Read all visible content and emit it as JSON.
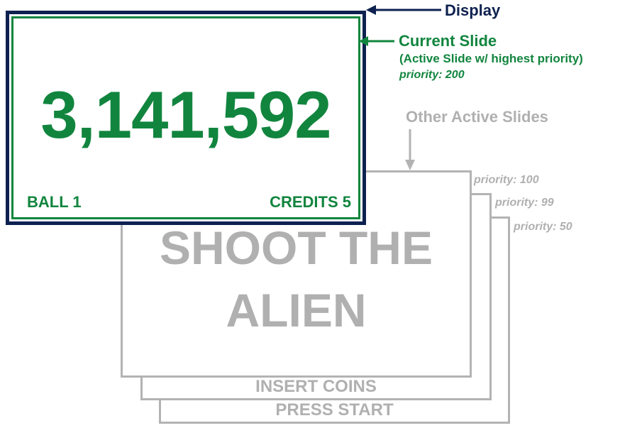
{
  "display": {
    "label": "Display",
    "score": "3,141,592",
    "ball": "BALL 1",
    "credits": "CREDITS 5"
  },
  "current_slide": {
    "label": "Current Slide",
    "description": "(Active Slide w/ highest priority)",
    "priority": "priority: 200"
  },
  "other_slides": {
    "label": "Other Active Slides",
    "slides": [
      {
        "priority": "priority: 100",
        "text_line1": "SHOOT THE",
        "text_line2": "ALIEN"
      },
      {
        "priority": "priority: 99",
        "text": "INSERT COINS"
      },
      {
        "priority": "priority: 50",
        "text": "PRESS START"
      }
    ]
  },
  "colors": {
    "navy": "#0e2150",
    "green": "#11853e",
    "gray": "#b3b3b3"
  }
}
